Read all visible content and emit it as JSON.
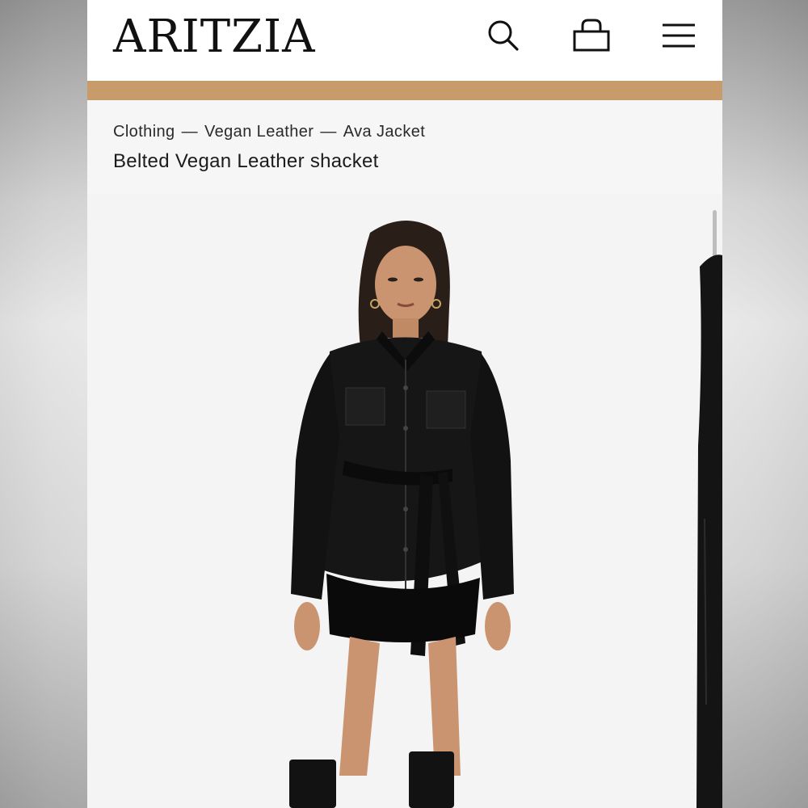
{
  "header": {
    "logo": "ARITZIA",
    "icons": [
      "search-icon",
      "shopping-bag-icon",
      "menu-icon"
    ]
  },
  "promo_bar": {
    "color": "#c89b6a"
  },
  "breadcrumb": {
    "items": [
      "Clothing",
      "Vegan Leather",
      "Ava Jacket"
    ],
    "separator": "—"
  },
  "product": {
    "title": "Belted Vegan Leather shacket"
  },
  "gallery": {
    "main_image": "model-wearing-black-belted-vegan-leather-shacket",
    "next_image": "next-product-image-peek"
  },
  "colors": {
    "header_bg": "#ffffff",
    "page_bg": "#f6f6f6",
    "accent": "#c89b6a",
    "text": "#1c1c1c"
  }
}
